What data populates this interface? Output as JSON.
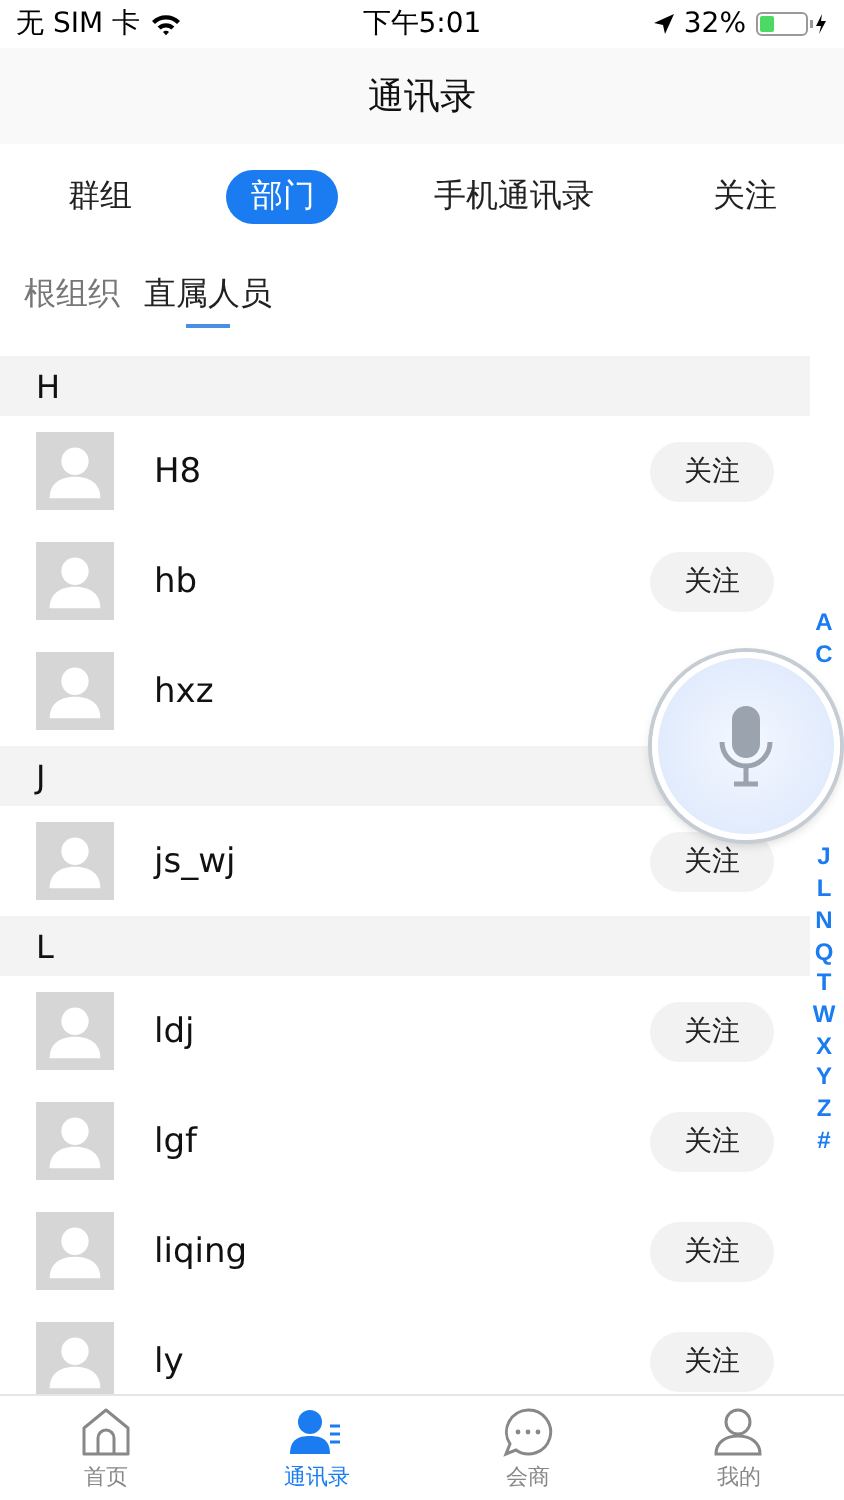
{
  "status_bar": {
    "carrier": "无 SIM 卡",
    "time": "下午5:01",
    "battery": "32%"
  },
  "title": "通讯录",
  "tabs": [
    {
      "label": "群组",
      "selected": false
    },
    {
      "label": "部门",
      "selected": true
    },
    {
      "label": "手机通讯录",
      "selected": false
    },
    {
      "label": "关注",
      "selected": false
    }
  ],
  "breadcrumbs": [
    {
      "label": "根组织",
      "selected": false
    },
    {
      "label": "直属人员",
      "selected": true
    }
  ],
  "sections": [
    {
      "letter": "H",
      "contacts": [
        {
          "name": "H8",
          "follow": "关注"
        },
        {
          "name": "hb",
          "follow": "关注"
        },
        {
          "name": "hxz"
        }
      ]
    },
    {
      "letter": "J",
      "contacts": [
        {
          "name": "js_wj",
          "follow": "关注"
        }
      ]
    },
    {
      "letter": "L",
      "contacts": [
        {
          "name": "ldj",
          "follow": "关注"
        },
        {
          "name": "lgf",
          "follow": "关注"
        },
        {
          "name": "liqing",
          "follow": "关注"
        },
        {
          "name": "ly",
          "follow": "关注"
        }
      ]
    }
  ],
  "index_letters": [
    "A",
    "C",
    "J",
    "L",
    "N",
    "Q",
    "T",
    "W",
    "X",
    "Y",
    "Z",
    "#"
  ],
  "bottom_tabs": [
    {
      "label": "首页",
      "kind": "home",
      "selected": false
    },
    {
      "label": "通讯录",
      "kind": "contacts",
      "selected": true
    },
    {
      "label": "会商",
      "kind": "chat",
      "selected": false
    },
    {
      "label": "我的",
      "kind": "profile",
      "selected": false
    }
  ]
}
